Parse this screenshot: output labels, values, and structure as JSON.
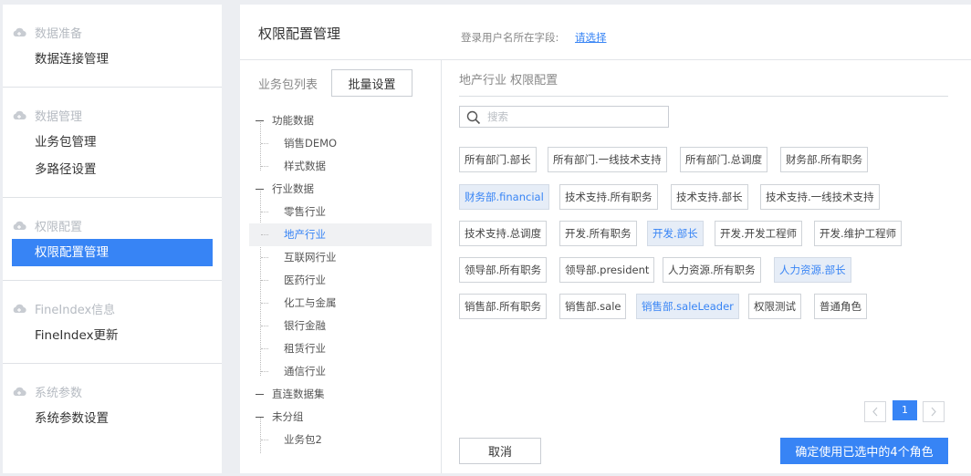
{
  "sidebar": {
    "groups": [
      {
        "header": "数据准备",
        "items": [
          {
            "label": "数据连接管理"
          }
        ]
      },
      {
        "header": "数据管理",
        "items": [
          {
            "label": "业务包管理"
          },
          {
            "label": "多路径设置"
          }
        ]
      },
      {
        "header": "权限配置",
        "items": [
          {
            "label": "权限配置管理",
            "active": true
          }
        ]
      },
      {
        "header": "FineIndex信息",
        "items": [
          {
            "label": "FineIndex更新"
          }
        ]
      },
      {
        "header": "系统参数",
        "items": [
          {
            "label": "系统参数设置"
          }
        ]
      }
    ]
  },
  "header": {
    "title": "权限配置管理",
    "login_field_label": "登录用户名所在字段:",
    "login_field_link": "请选择"
  },
  "package_panel": {
    "label": "业务包列表",
    "batch_button": "批量设置",
    "tree": [
      {
        "label": "功能数据",
        "children": [
          "销售DEMO",
          "样式数据"
        ]
      },
      {
        "label": "行业数据",
        "children": [
          "零售行业",
          "地产行业",
          "互联网行业",
          "医药行业",
          "化工与金属",
          "银行金融",
          "租赁行业",
          "通信行业"
        ]
      },
      {
        "label": "直连数据集",
        "children": []
      },
      {
        "label": "未分组",
        "children": [
          "业务包2"
        ]
      }
    ],
    "selected": "地产行业"
  },
  "config": {
    "title": "地产行业 权限配置",
    "search_placeholder": "搜索",
    "roles": [
      {
        "label": "所有部门.部长",
        "selected": false
      },
      {
        "label": "所有部门.一线技术支持",
        "selected": false
      },
      {
        "label": "所有部门.总调度",
        "selected": false
      },
      {
        "label": "财务部.所有职务",
        "selected": false
      },
      {
        "label": "财务部.financial",
        "selected": true
      },
      {
        "label": "技术支持.所有职务",
        "selected": false
      },
      {
        "label": "技术支持.部长",
        "selected": false
      },
      {
        "label": "技术支持.一线技术支持",
        "selected": false
      },
      {
        "label": "技术支持.总调度",
        "selected": false
      },
      {
        "label": "开发.所有职务",
        "selected": false
      },
      {
        "label": "开发.部长",
        "selected": true
      },
      {
        "label": "开发.开发工程师",
        "selected": false
      },
      {
        "label": "开发.维护工程师",
        "selected": false
      },
      {
        "label": "领导部.所有职务",
        "selected": false
      },
      {
        "label": "领导部.president",
        "selected": false
      },
      {
        "label": "人力资源.所有职务",
        "selected": false
      },
      {
        "label": "人力资源.部长",
        "selected": true
      },
      {
        "label": "销售部.所有职务",
        "selected": false
      },
      {
        "label": "销售部.sale",
        "selected": false
      },
      {
        "label": "销售部.saleLeader",
        "selected": true
      },
      {
        "label": "权限测试",
        "selected": false
      },
      {
        "label": "普通角色",
        "selected": false
      }
    ],
    "pagination": {
      "current_page": "1"
    },
    "cancel_button": "取消",
    "confirm_button": "确定使用已选中的4个角色"
  },
  "colors": {
    "accent": "#3784f5",
    "selected_role_bg": "#e6edf7",
    "page_bg": "#eceef2"
  }
}
